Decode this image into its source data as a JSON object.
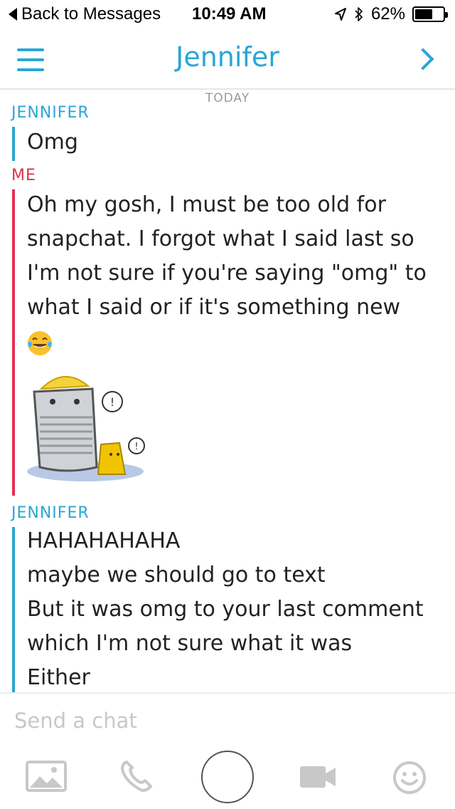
{
  "status_bar": {
    "back_label": "Back to Messages",
    "time": "10:49 AM",
    "battery_percent_text": "62%",
    "battery_level": 0.62
  },
  "header": {
    "title": "Jennifer",
    "menu_icon": "menu-icon",
    "forward_icon": "chevron-right-icon"
  },
  "conversation": {
    "date_label": "TODAY",
    "messages": [
      {
        "sender": "JENNIFER",
        "lines": [
          "Omg"
        ]
      },
      {
        "sender": "ME",
        "lines": [
          "Oh my gosh, I must be too old for",
          "snapchat. I forgot what I said last so",
          "I'm not sure if you're saying \"omg\" to",
          "what I said or if it's something new"
        ],
        "emoji": "tears-of-joy-emoji",
        "sticker": "confused-trash-can-sticker"
      },
      {
        "sender": "JENNIFER",
        "lines": [
          "HAHAHAHAHA",
          "maybe we should go to text",
          "But it was omg to your last comment",
          "which I'm not sure what it was",
          "Either"
        ]
      }
    ]
  },
  "composer": {
    "placeholder": "Send a chat"
  },
  "colors": {
    "accent_blue": "#2aa6d6",
    "me_red": "#e0304e",
    "icon_gray": "#c8c8c8"
  }
}
